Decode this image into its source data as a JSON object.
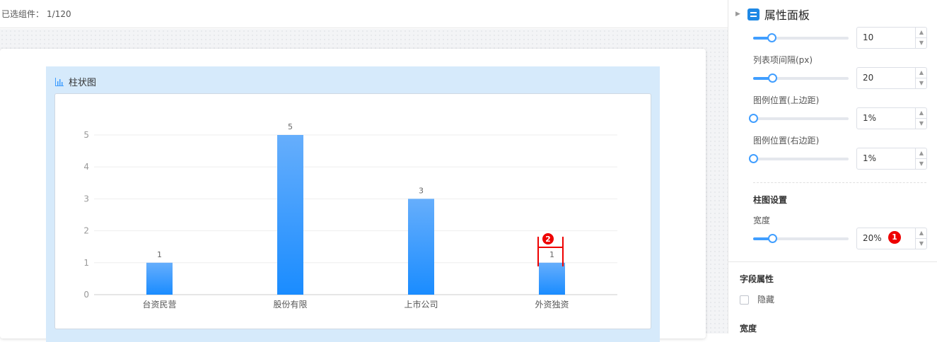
{
  "topbar": {
    "label": "已选组件：",
    "count": "1/120"
  },
  "widget": {
    "title": "柱状图"
  },
  "chart_data": {
    "type": "bar",
    "categories": [
      "台资民营",
      "股份有限",
      "上市公司",
      "外资独资"
    ],
    "values": [
      1,
      5,
      3,
      1
    ],
    "ylim": [
      0,
      5
    ],
    "yticks": [
      "0",
      "1",
      "2",
      "3",
      "4",
      "5"
    ],
    "grid": true,
    "bar_color_top": "#66aefc",
    "bar_color_bottom": "#1a8cff"
  },
  "annotation_marker": "2",
  "panel": {
    "title": "属性面板",
    "rows": [
      {
        "label": "",
        "value": "10",
        "level": 0.19
      },
      {
        "label": "列表项间隔(px)",
        "value": "20",
        "level": 0.2
      },
      {
        "label": "图例位置(上边距)",
        "value": "1%",
        "level": 0.0
      },
      {
        "label": "图例位置(右边距)",
        "value": "1%",
        "level": 0.0
      }
    ],
    "bar_section": {
      "title": "柱图设置",
      "width_label": "宽度",
      "width_value": "20%",
      "width_level": 0.2,
      "marker": "1"
    },
    "field_section": {
      "title": "字段属性",
      "hide_label": "隐藏"
    },
    "width_section": {
      "title": "宽度"
    }
  },
  "colors": {
    "accent": "#409eff",
    "marker": "#e00000"
  }
}
